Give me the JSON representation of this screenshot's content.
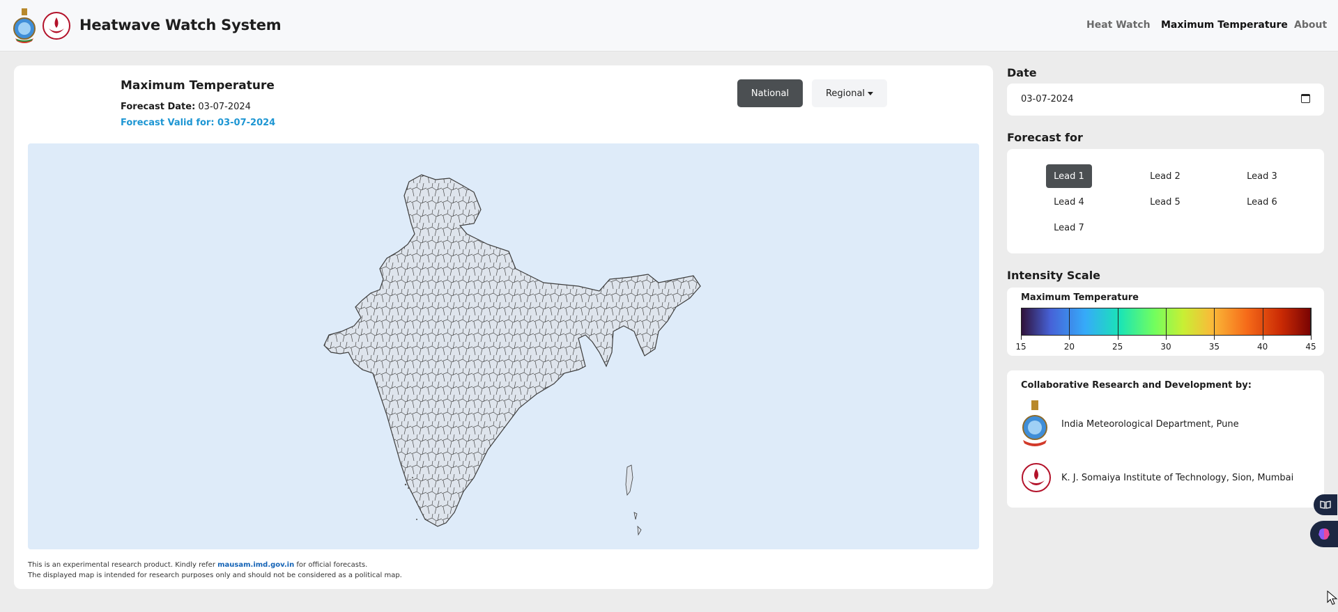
{
  "header": {
    "title": "Heatwave Watch System",
    "nav": [
      {
        "label": "Heat Watch"
      },
      {
        "label": "Maximum Temperature"
      },
      {
        "label": "About"
      }
    ],
    "logos": [
      "imd-emblem-icon",
      "somaiya-logo-icon"
    ]
  },
  "main": {
    "title": "Maximum Temperature",
    "forecast_date_label": "Forecast Date:",
    "forecast_date": "03-07-2024",
    "forecast_valid": "Forecast Valid for: 03-07-2024",
    "view_buttons": {
      "national": "National",
      "regional": "Regional",
      "active": "national"
    },
    "map": {
      "background": "#deebf9",
      "region": "India district map"
    },
    "disclaimer": {
      "line1_pre": "This is an experimental research product. Kindly refer",
      "line1_link": "mausam.imd.gov.in",
      "line1_post": "for official forecasts.",
      "line2": "The displayed map is intended for research purposes only and should not be considered as a political map."
    }
  },
  "sidebar": {
    "date_label": "Date",
    "date_value": "03-07-2024",
    "forecast_label": "Forecast for",
    "leads": [
      "Lead 1",
      "Lead 2",
      "Lead 3",
      "Lead 4",
      "Lead 5",
      "Lead 6",
      "Lead 7"
    ],
    "active_lead": "Lead 1",
    "scale_label": "Intensity Scale",
    "scale": {
      "title": "Maximum Temperature",
      "ticks": [
        "15",
        "20",
        "25",
        "30",
        "35",
        "40",
        "45"
      ],
      "min": 15,
      "max": 45
    },
    "collab": {
      "title": "Collaborative Research and Development by:",
      "orgs": [
        {
          "name": "India Meteorological Department, Pune"
        },
        {
          "name": "K. J. Somaiya Institute of Technology, Sion, Mumbai"
        }
      ]
    }
  },
  "colors": {
    "active_button": "#4b4f52",
    "link_blue": "#1e96d3",
    "map_bg": "#deebf9"
  }
}
